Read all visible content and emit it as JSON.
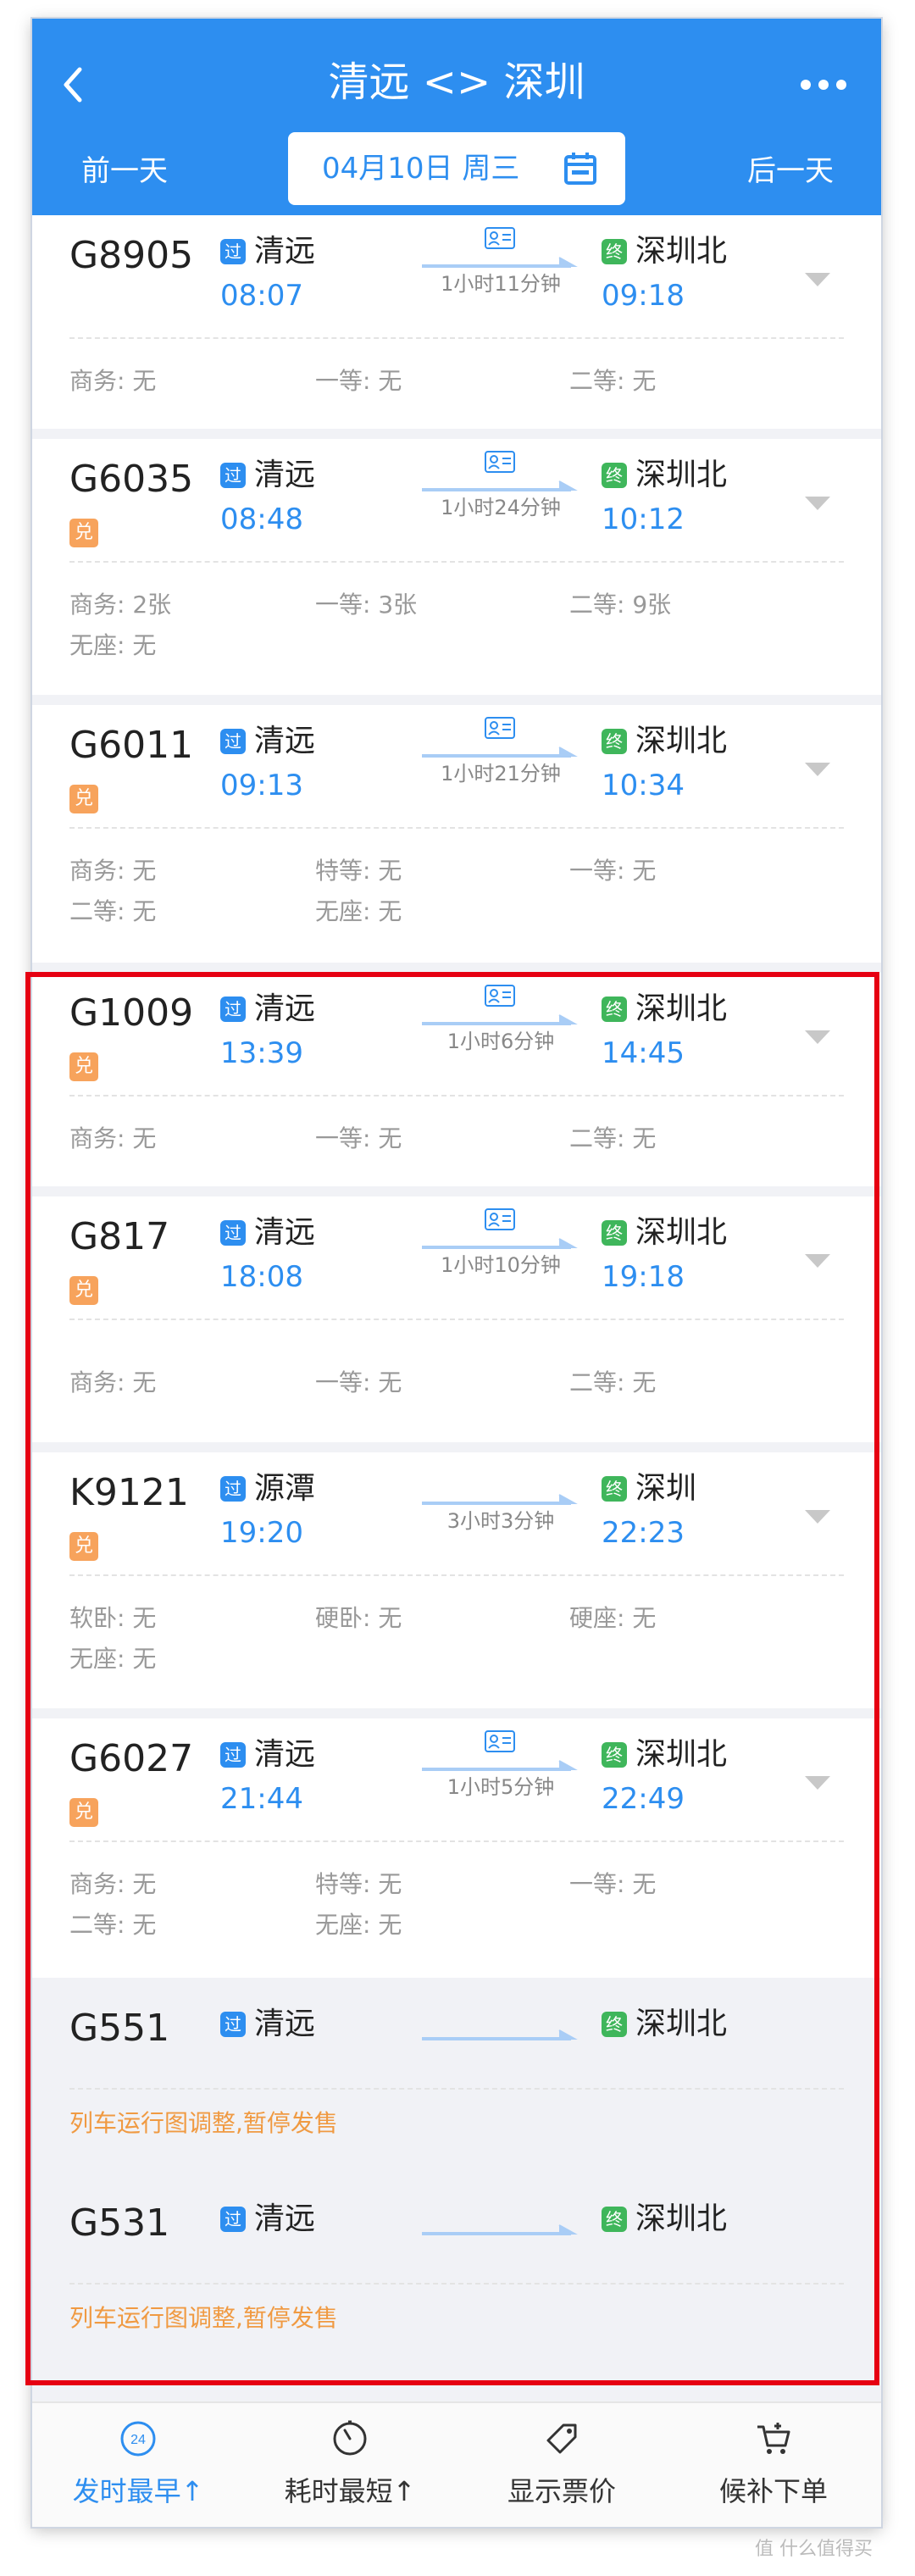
{
  "header": {
    "title": "清远 <> 深圳",
    "prev_day": "前一天",
    "next_day": "后一天",
    "date": "04月10日 周三"
  },
  "colors": {
    "accent": "#2d8ef0",
    "red_highlight": "#e60012",
    "orange": "#f09a42",
    "green": "#3fb65b"
  },
  "badges": {
    "guo": "过",
    "zhong": "终",
    "dui": "兑"
  },
  "trains": [
    {
      "no": "G8905",
      "dui": false,
      "from": "清远",
      "dep": "08:07",
      "duration": "1小时11分钟",
      "to": "深圳北",
      "arr": "09:18",
      "seats": [
        [
          "商务: 无",
          "一等: 无",
          "二等: 无"
        ]
      ]
    },
    {
      "no": "G6035",
      "dui": true,
      "from": "清远",
      "dep": "08:48",
      "duration": "1小时24分钟",
      "to": "深圳北",
      "arr": "10:12",
      "seats": [
        [
          "商务: 2张",
          "一等: 3张",
          "二等: 9张"
        ],
        [
          "无座: 无"
        ]
      ]
    },
    {
      "no": "G6011",
      "dui": true,
      "from": "清远",
      "dep": "09:13",
      "duration": "1小时21分钟",
      "to": "深圳北",
      "arr": "10:34",
      "seats": [
        [
          "商务: 无",
          "特等: 无",
          "一等: 无"
        ],
        [
          "二等: 无",
          "无座: 无"
        ]
      ]
    },
    {
      "no": "G1009",
      "dui": true,
      "from": "清远",
      "dep": "13:39",
      "duration": "1小时6分钟",
      "to": "深圳北",
      "arr": "14:45",
      "seats": [
        [
          "商务: 无",
          "一等: 无",
          "二等: 无"
        ]
      ]
    },
    {
      "no": "G817",
      "dui": true,
      "from": "清远",
      "dep": "18:08",
      "duration": "1小时10分钟",
      "to": "深圳北",
      "arr": "19:18",
      "seats": [
        [
          "商务: 无",
          "一等: 无",
          "二等: 无"
        ]
      ]
    },
    {
      "no": "K9121",
      "dui": true,
      "from": "源潭",
      "dep": "19:20",
      "duration": "3小时3分钟",
      "to": "深圳",
      "arr": "22:23",
      "seats": [
        [
          "软卧: 无",
          "硬卧: 无",
          "硬座: 无"
        ],
        [
          "无座: 无"
        ]
      ]
    },
    {
      "no": "G6027",
      "dui": true,
      "from": "清远",
      "dep": "21:44",
      "duration": "1小时5分钟",
      "to": "深圳北",
      "arr": "22:49",
      "seats": [
        [
          "商务: 无",
          "特等: 无",
          "一等: 无"
        ],
        [
          "二等: 无",
          "无座: 无"
        ]
      ]
    },
    {
      "no": "G551",
      "from": "清远",
      "to": "深圳北",
      "status": "列车运行图调整,暂停发售"
    },
    {
      "no": "G531",
      "from": "清远",
      "to": "深圳北",
      "status": "列车运行图调整,暂停发售"
    }
  ],
  "bottom_tabs": [
    {
      "label": "发时最早↑",
      "icon": "clock-24-icon",
      "icon_text": "24",
      "active": true
    },
    {
      "label": "耗时最短↑",
      "icon": "timer-icon",
      "active": false
    },
    {
      "label": "显示票价",
      "icon": "price-tag-icon",
      "active": false
    },
    {
      "label": "候补下单",
      "icon": "cart-plus-icon",
      "active": false
    }
  ],
  "watermark": "值 什么值得买"
}
